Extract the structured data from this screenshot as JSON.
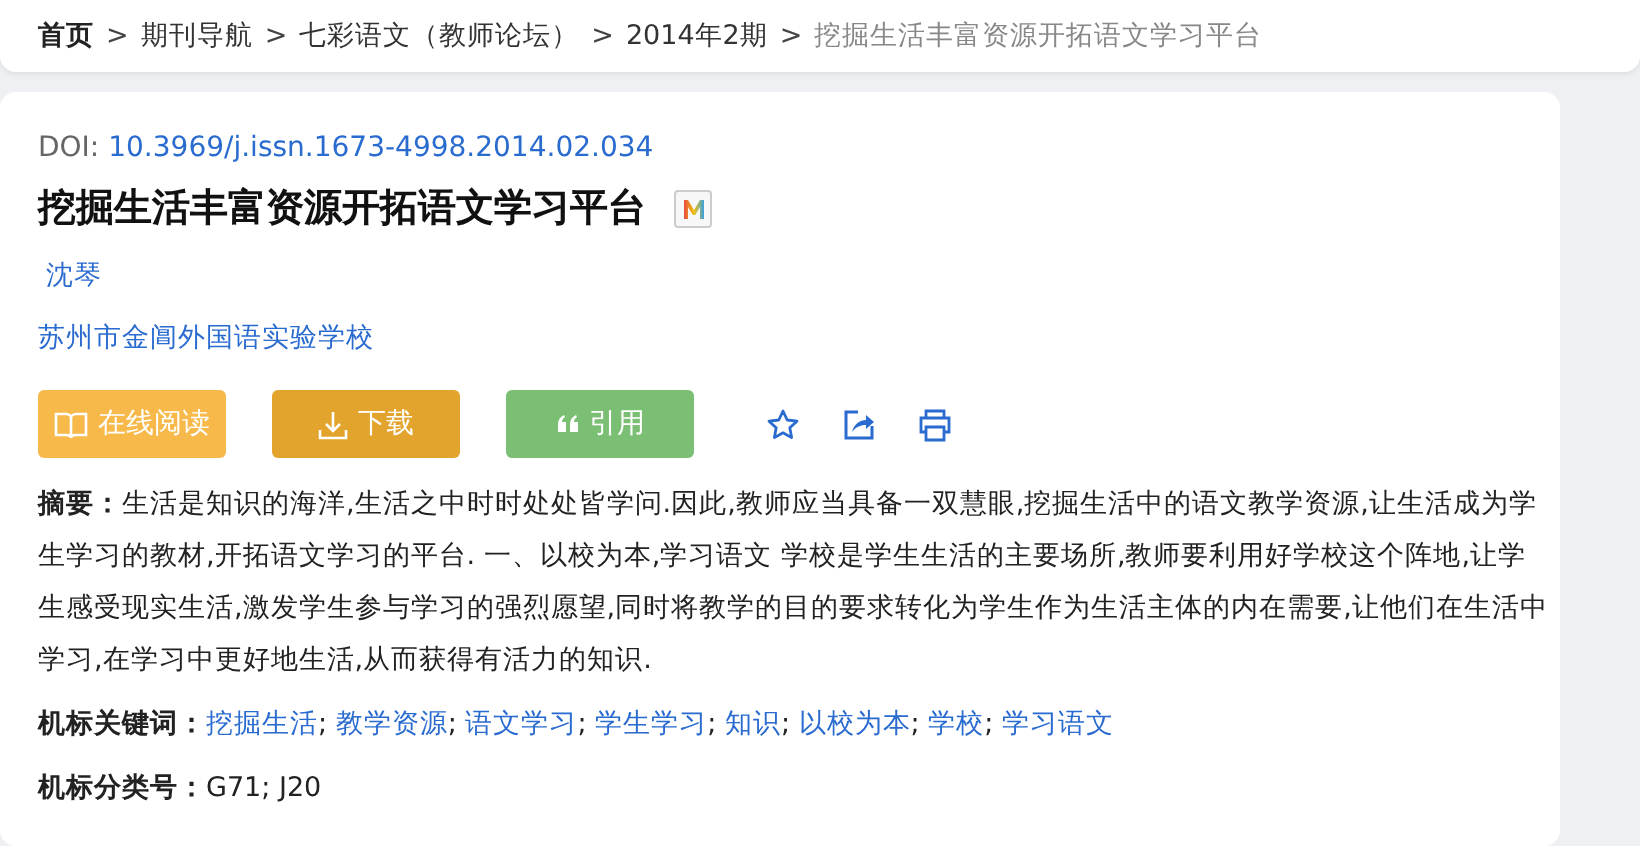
{
  "breadcrumb": {
    "separator": ">",
    "items": [
      {
        "label": "首页",
        "kind": "home"
      },
      {
        "label": "期刊导航",
        "kind": "link"
      },
      {
        "label": "七彩语文（教师论坛）",
        "kind": "link"
      },
      {
        "label": "2014年2期",
        "kind": "link"
      },
      {
        "label": "挖掘生活丰富资源开拓语文学习平台",
        "kind": "current"
      }
    ]
  },
  "article": {
    "doi_label": "DOI:",
    "doi": "10.3969/j.issn.1673-4998.2014.02.034",
    "title": "挖掘生活丰富资源开拓语文学习平台",
    "authors": [
      "沈琴"
    ],
    "affiliation": "苏州市金阊外国语实验学校",
    "actions": [
      {
        "label": "在线阅读",
        "kind": "read"
      },
      {
        "label": "下载",
        "kind": "download"
      },
      {
        "label": "引用",
        "kind": "cite"
      }
    ],
    "tools": [
      {
        "kind": "favorite"
      },
      {
        "kind": "share"
      },
      {
        "kind": "print"
      }
    ],
    "abstract": "**摘要：**生活是知识的海洋,生活之中时时处处皆学问.因此,教师应当具备一双慧眼,挖掘生活中的语文教学资源,让生活成为学生学习的教材,开拓语文学习的平台. 一、以校为本,学习语文 学校是学生生活的主要场所,教师要利用好学校这个阵地,让学生感受现实生活,激发学生参与学习的强烈愿望,同时将教学的目的要求转化为学生作为生活主体的内在需要,让他们在生活中学习,在学习中更好地生活,从而获得有活力的知识.",
    "keywords_label": "机标关键词：",
    "keyword_separator": ";",
    "keywords": [
      "挖掘生活",
      "教学资源",
      "语文学习",
      "学生学习",
      "知识",
      "以校为本",
      "学校",
      "学习语文"
    ],
    "classification": "**机标分类号：**G71; J20"
  }
}
